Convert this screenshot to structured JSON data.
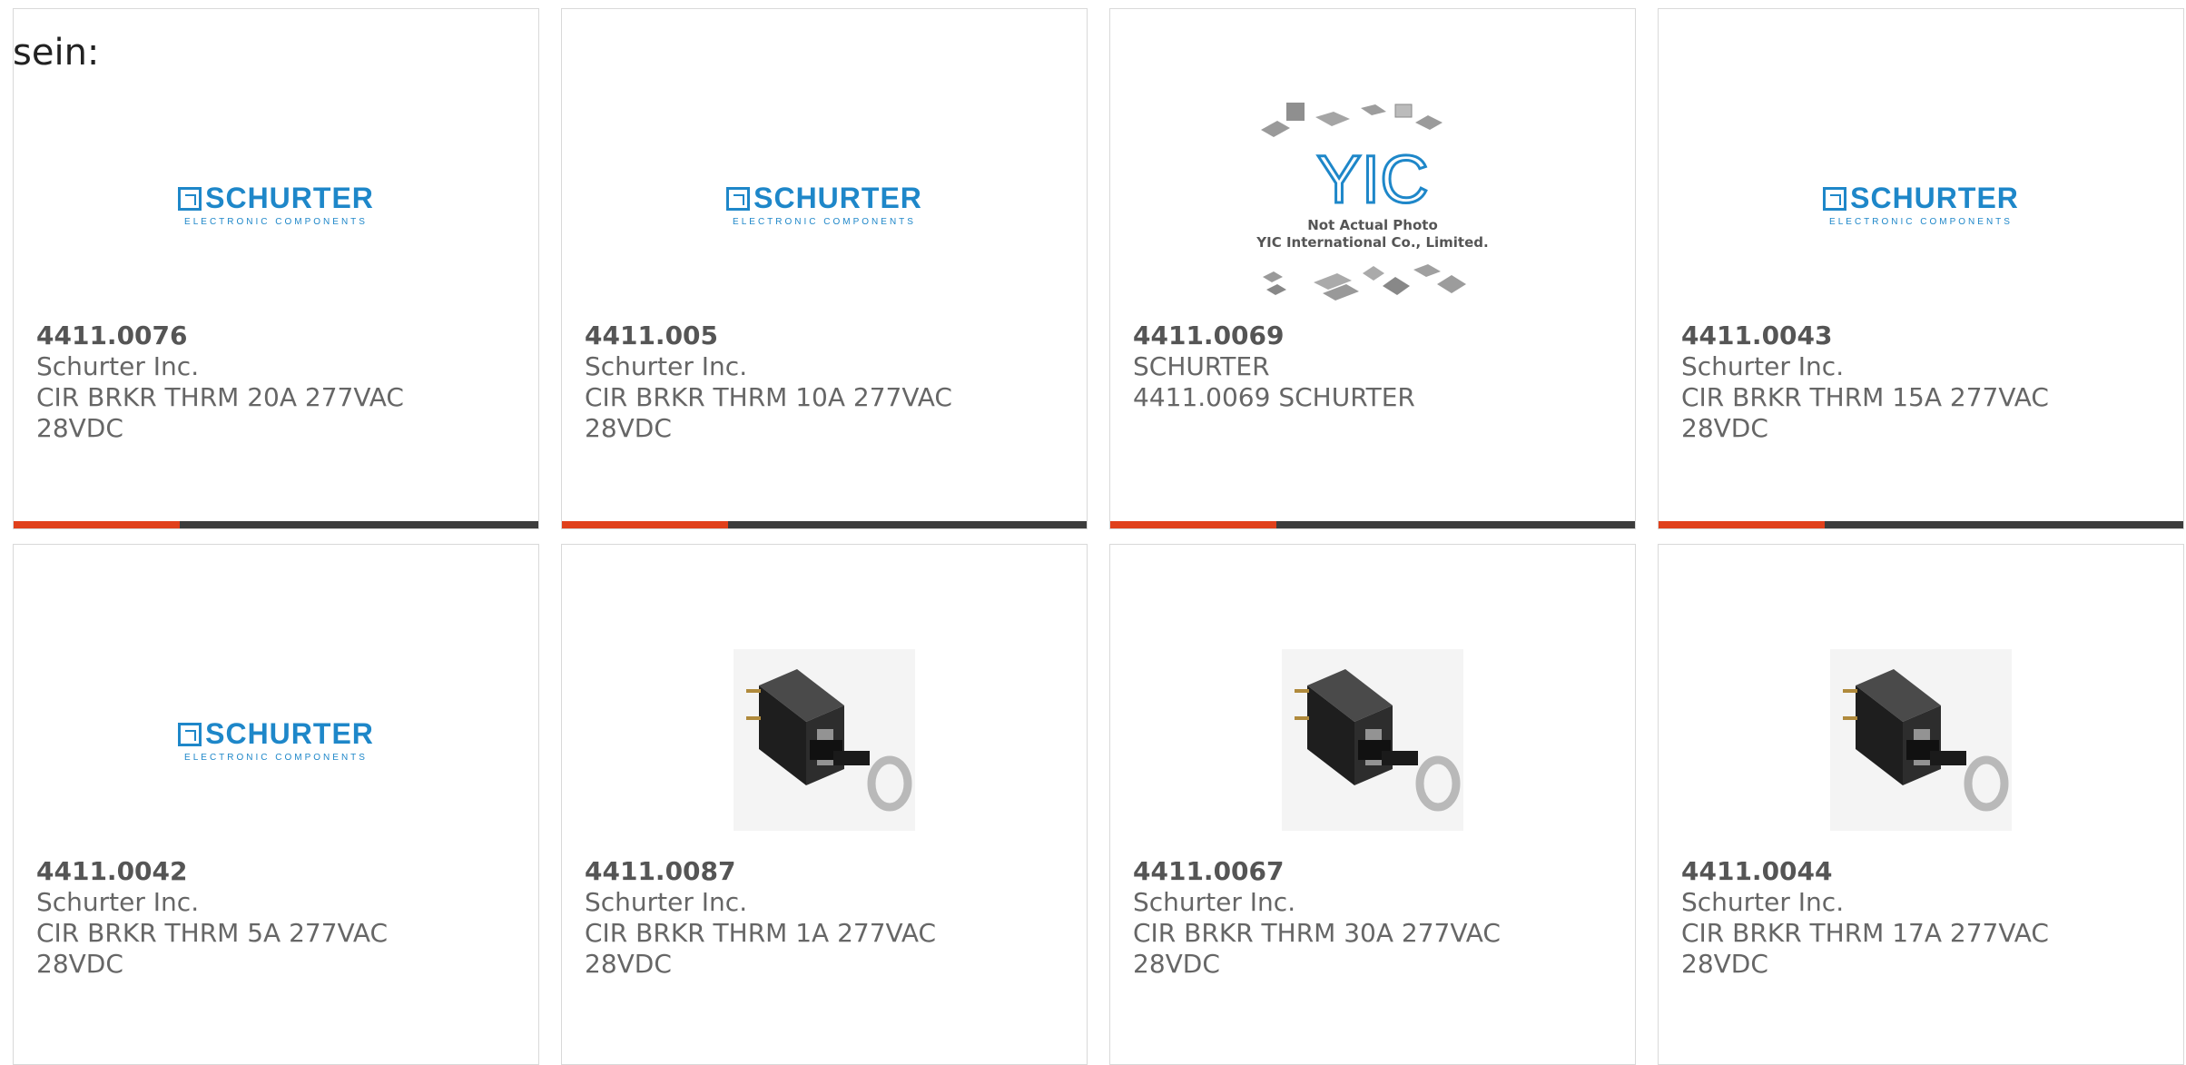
{
  "intro": "sein:",
  "logo": {
    "word": "SCHURTER",
    "sub": "ELECTRONIC COMPONENTS"
  },
  "yic": {
    "l1": "Not Actual Photo",
    "l2": "YIC International Co., Limited."
  },
  "colors": {
    "accent": "#e0401b",
    "bar": "#3c3c3c",
    "logo_blue": "#1e87c9"
  },
  "products": [
    {
      "pn": "4411.0076",
      "mfr": "Schurter Inc.",
      "desc1": "CIR BRKR THRM 20A 277VAC",
      "desc2": "28VDC",
      "image": "schurter-logo"
    },
    {
      "pn": "4411.005",
      "mfr": "Schurter Inc.",
      "desc1": "CIR BRKR THRM 10A 277VAC",
      "desc2": "28VDC",
      "image": "schurter-logo"
    },
    {
      "pn": "4411.0069",
      "mfr": "SCHURTER",
      "desc1": "4411.0069 SCHURTER",
      "desc2": "",
      "image": "not-actual-photo"
    },
    {
      "pn": "4411.0043",
      "mfr": "Schurter Inc.",
      "desc1": "CIR BRKR THRM 15A 277VAC",
      "desc2": "28VDC",
      "image": "schurter-logo"
    },
    {
      "pn": "4411.0042",
      "mfr": "Schurter Inc.",
      "desc1": "CIR BRKR THRM 5A 277VAC",
      "desc2": "28VDC",
      "image": "schurter-logo"
    },
    {
      "pn": "4411.0087",
      "mfr": "Schurter Inc.",
      "desc1": "CIR BRKR THRM 1A 277VAC",
      "desc2": "28VDC",
      "image": "breaker-photo"
    },
    {
      "pn": "4411.0067",
      "mfr": "Schurter Inc.",
      "desc1": "CIR BRKR THRM 30A 277VAC",
      "desc2": "28VDC",
      "image": "breaker-photo"
    },
    {
      "pn": "4411.0044",
      "mfr": "Schurter Inc.",
      "desc1": "CIR BRKR THRM 17A 277VAC",
      "desc2": "28VDC",
      "image": "breaker-photo"
    }
  ]
}
